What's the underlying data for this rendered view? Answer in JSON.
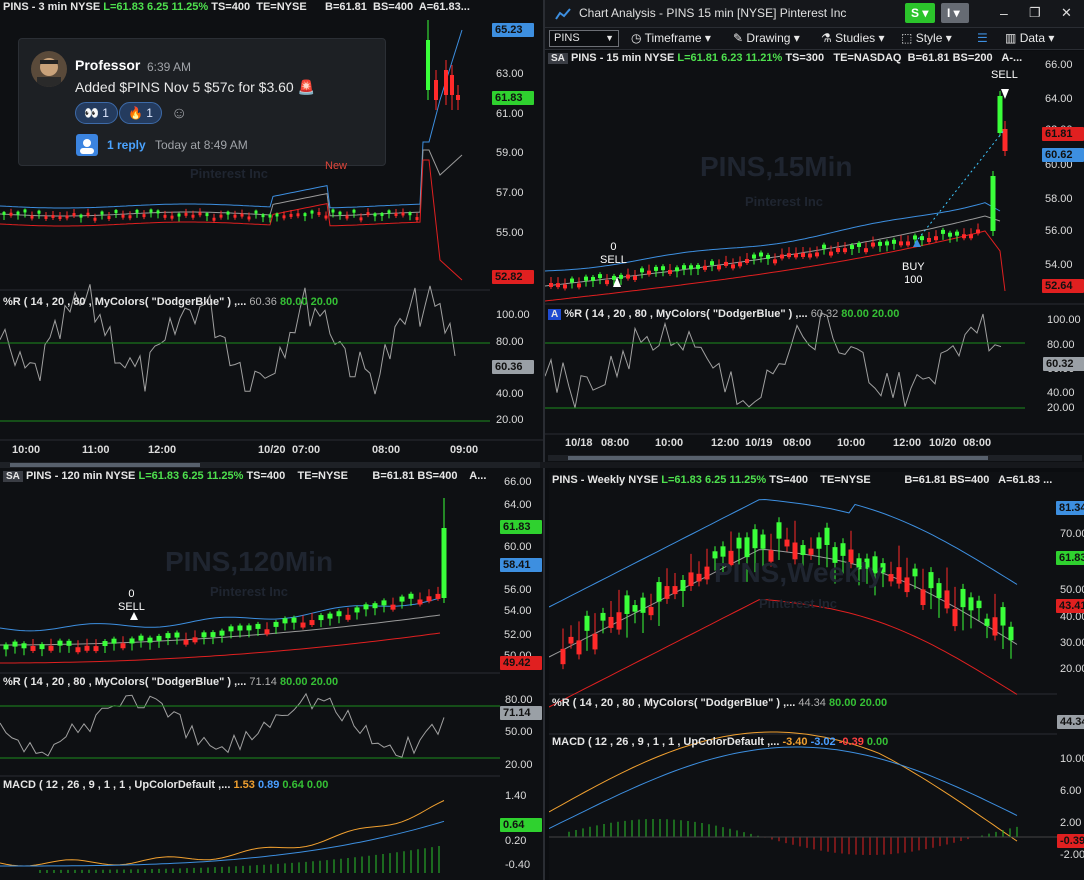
{
  "window": {
    "title": "Chart Analysis - PINS 15 min [NYSE] Pinterest Inc",
    "badge_s": "S",
    "badge_i": "I",
    "minimize": "–",
    "restore": "❐",
    "close": "✕"
  },
  "toolbar": {
    "symbol": "PINS",
    "timeframe": "Timeframe",
    "drawing": "Drawing",
    "studies": "Studies",
    "style": "Style",
    "data": "Data"
  },
  "chat": {
    "user": "Professor",
    "time": "6:39 AM",
    "message": "Added $PINS Nov 5 $57c for $3.60 🚨",
    "reactions": [
      {
        "emoji": "👀",
        "count": "1"
      },
      {
        "emoji": "🔥",
        "count": "1"
      }
    ],
    "reply_link": "1 reply",
    "reply_time": "Today at 8:49 AM",
    "new_label": "New"
  },
  "pane3min": {
    "header": {
      "sym": "PINS - 3 min  NYSE",
      "last": "L=61.83",
      "chg": "6.25",
      "pct": "11.25%",
      "ts": "TS=400",
      "te": "TE=NYSE",
      "bid": "B=61.81",
      "bs": "BS=400",
      "ask": "A=61.83..."
    },
    "watermark": "Pinterest Inc",
    "price_ticks": [
      "63.00",
      "61.00",
      "59.00",
      "57.00",
      "55.00"
    ],
    "tags": [
      {
        "v": "65.23",
        "c": "#3d8fe0"
      },
      {
        "v": "61.83",
        "c": "#2fd12f"
      },
      {
        "v": "52.82",
        "c": "#e02020"
      }
    ],
    "wr_label": "%R ( 14 , 20 , 80 , MyColors( \"DodgerBlue\" ) ,...",
    "wr_vals": [
      "60.36",
      "80.00",
      "20.00"
    ],
    "wr_ticks": [
      "100.00",
      "80.00",
      "60.00",
      "40.00",
      "20.00"
    ],
    "wr_tag": "60.36",
    "x_labels": [
      "10:00",
      "11:00",
      "12:00",
      "10/20",
      "07:00",
      "08:00",
      "09:00"
    ]
  },
  "pane15min": {
    "header": {
      "sym": "PINS - 15 min  NYSE",
      "last": "L=61.81",
      "chg": "6.23",
      "pct": "11.21%",
      "ts": "TS=300",
      "te": "TE=NASDAQ",
      "bid": "B=61.81",
      "bs": "BS=200",
      "ask": "A-..."
    },
    "badge": "SA",
    "watermark": "PINS,15Min",
    "watermark2": "Pinterest Inc",
    "price_ticks": [
      "66.00",
      "64.00",
      "62.00",
      "60.00",
      "58.00",
      "56.00",
      "54.00"
    ],
    "tags": [
      {
        "v": "61.81",
        "c": "#e02020"
      },
      {
        "v": "60.62",
        "c": "#3d8fe0"
      },
      {
        "v": "52.64",
        "c": "#e02020"
      }
    ],
    "sell1": [
      "0",
      "SELL"
    ],
    "buy": [
      "BUY",
      "100"
    ],
    "sell2": "SELL",
    "wr_label": "%R ( 14 , 20 , 80 , MyColors( \"DodgerBlue\" ) ,...",
    "wr_vals": [
      "60.32",
      "80.00",
      "20.00"
    ],
    "wr_ticks": [
      "100.00",
      "80.00",
      "60.00",
      "40.00",
      "20.00"
    ],
    "wr_tag": "60.32",
    "x_labels": [
      "10/18",
      "08:00",
      "10:00",
      "12:00",
      "10/19",
      "08:00",
      "10:00",
      "12:00",
      "10/20",
      "08:00"
    ]
  },
  "pane120": {
    "header": {
      "sym": "PINS - 120 min  NYSE",
      "last": "L=61.83",
      "chg": "6.25",
      "pct": "11.25%",
      "ts": "TS=400",
      "te": "TE=NYSE",
      "bid": "B=61.81",
      "bs": "BS=400",
      "ask": "A..."
    },
    "badge": "SA",
    "watermark": "PINS,120Min",
    "watermark2": "Pinterest Inc",
    "price_ticks": [
      "66.00",
      "64.00",
      "60.00",
      "56.00",
      "54.00",
      "52.00",
      "50.00"
    ],
    "tags": [
      {
        "v": "61.83",
        "c": "#2fd12f"
      },
      {
        "v": "58.41",
        "c": "#3d8fe0"
      },
      {
        "v": "49.42",
        "c": "#e02020"
      }
    ],
    "sell": [
      "0",
      "SELL"
    ],
    "wr_label": "%R ( 14 , 20 , 80 , MyColors( \"DodgerBlue\" ) ,...",
    "wr_vals": [
      "71.14",
      "80.00",
      "20.00"
    ],
    "wr_ticks": [
      "80.00",
      "50.00",
      "20.00"
    ],
    "wr_tag": "71.14",
    "macd_label": "MACD ( 12 , 26 , 9 , 1 , 1 , UpColorDefault ,...",
    "macd_vals": [
      "1.53",
      "0.89",
      "0.64",
      "0.00"
    ],
    "macd_ticks": [
      "1.40",
      "0.20",
      "-0.40"
    ],
    "macd_tag": "0.64"
  },
  "paneWeekly": {
    "header": {
      "sym": "PINS - Weekly  NYSE",
      "last": "L=61.83",
      "chg": "6.25",
      "pct": "11.25%",
      "ts": "TS=400",
      "te": "TE=NYSE",
      "bid": "B=61.81",
      "bs": "BS=400",
      "ask": "A=61.83 ..."
    },
    "watermark": "PINS,Weekly",
    "watermark2": "Pinterest Inc",
    "price_ticks": [
      "70.00",
      "50.00",
      "40.00",
      "30.00",
      "20.00"
    ],
    "tags": [
      {
        "v": "81.34",
        "c": "#3d8fe0"
      },
      {
        "v": "61.83",
        "c": "#2fd12f"
      },
      {
        "v": "43.41",
        "c": "#e02020"
      }
    ],
    "wr_label": "%R ( 14 , 20 , 80 , MyColors( \"DodgerBlue\" ) ,...",
    "wr_vals": [
      "44.34",
      "80.00",
      "20.00"
    ],
    "wr_tag": "44.34",
    "macd_label": "MACD ( 12 , 26 , 9 , 1 , 1 , UpColorDefault ,...",
    "macd_vals": [
      "-3.40",
      "-3.02",
      "-0.39",
      "0.00"
    ],
    "macd_ticks": [
      "10.00",
      "6.00",
      "2.00",
      "-2.00"
    ],
    "macd_tag": "-0.39"
  },
  "colors": {
    "up": "#3aff3a",
    "down": "#ff2a2a",
    "upper": "#3d8fe0",
    "mid": "#9a9a9a",
    "lower": "#e02020",
    "wr": "#a0a0a0"
  }
}
